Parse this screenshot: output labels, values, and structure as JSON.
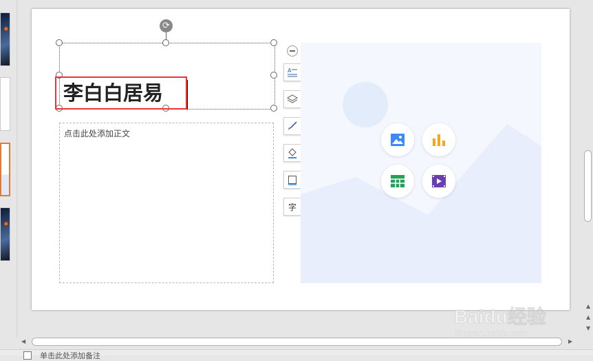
{
  "slide": {
    "title_text": "李白白居易",
    "body_placeholder": "点击此处添加正文"
  },
  "tools": [
    {
      "icon": "text-fit-icon"
    },
    {
      "icon": "layers-icon"
    },
    {
      "icon": "brush-icon"
    },
    {
      "icon": "fill-bucket-icon"
    },
    {
      "icon": "border-icon"
    },
    {
      "icon": "font-icon"
    }
  ],
  "tool_glyphs": {
    "font": "字"
  },
  "media": [
    {
      "icon": "picture-icon"
    },
    {
      "icon": "chart-icon"
    },
    {
      "icon": "table-icon"
    },
    {
      "icon": "video-icon"
    }
  ],
  "notes": {
    "label": "单击此处添加备注"
  },
  "watermark": {
    "logo": "Baidu经验",
    "sub": "jingyan.baidu.com"
  },
  "colors": {
    "accent_select": "#e33333",
    "active_thumb": "#e07b39",
    "media_bg": "#f4f7fd"
  }
}
